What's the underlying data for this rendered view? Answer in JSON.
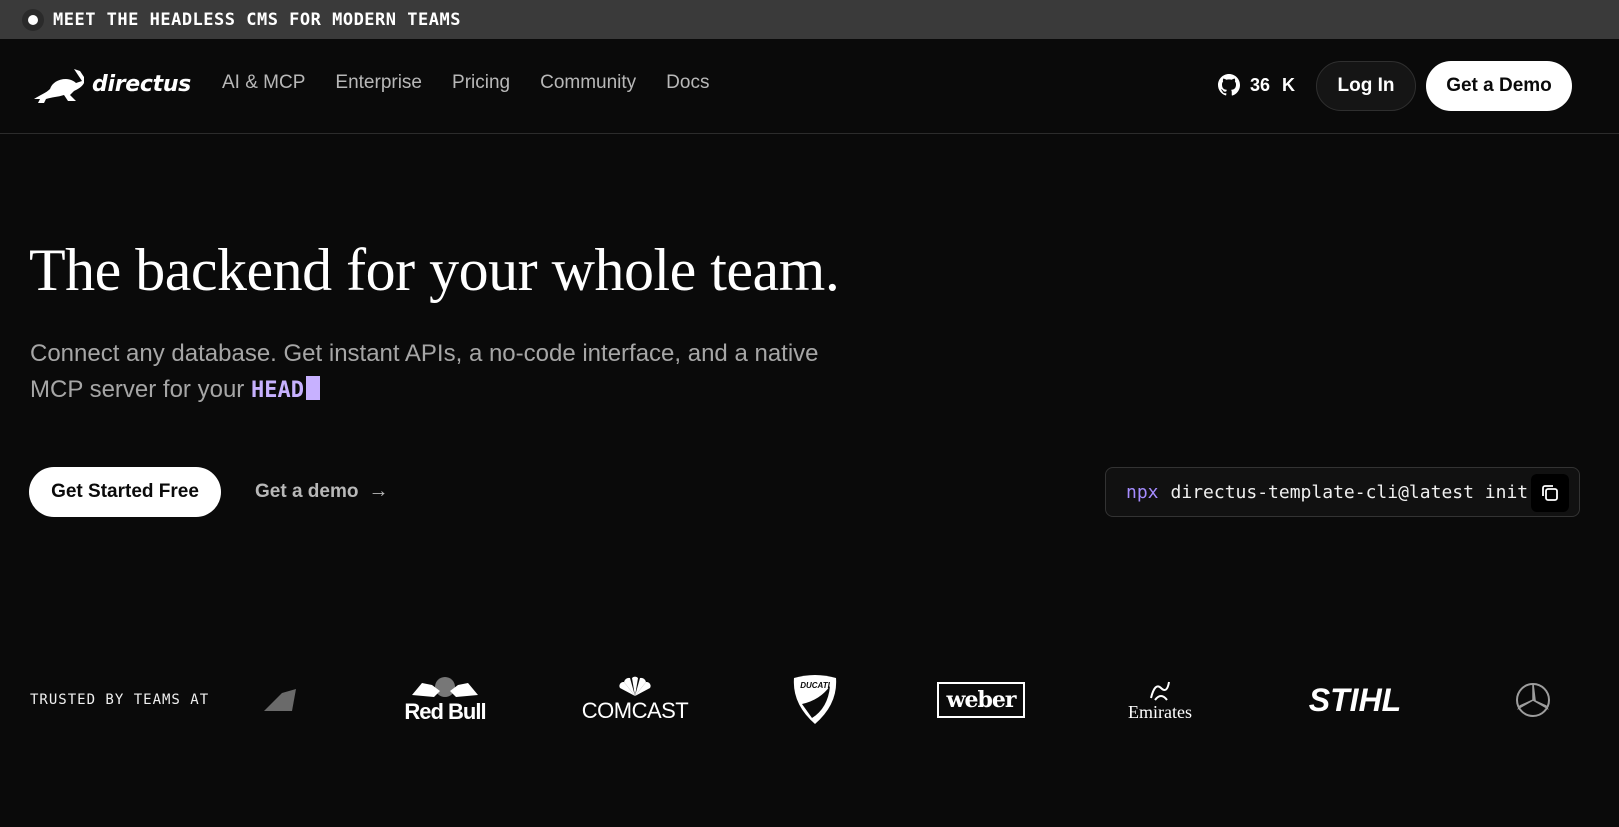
{
  "announcement": {
    "text": "MEET THE HEADLESS CMS FOR MODERN TEAMS"
  },
  "nav": {
    "brand": "directus",
    "links": [
      "AI & MCP",
      "Enterprise",
      "Pricing",
      "Community",
      "Docs"
    ],
    "github": {
      "stars": "36",
      "suffix": "K",
      "icon": "github-icon"
    },
    "login_label": "Log In",
    "demo_label": "Get a Demo"
  },
  "hero": {
    "title": "The backend for your whole team.",
    "subtitle": "Connect any database. Get instant APIs, a no-code interface, and a native MCP server for your",
    "typed_word": "HEAD",
    "primary_cta": "Get Started Free",
    "secondary_cta": "Get a demo",
    "command": {
      "prefix": "npx",
      "text": "directus-template-cli@latest init",
      "copy_icon": "copy-icon"
    }
  },
  "trusted": {
    "label": "TRUSTED BY TEAMS AT",
    "logos": [
      "Red Bull",
      "COMCAST",
      "DUCATI",
      "weber",
      "Emirates",
      "STIHL"
    ]
  },
  "colors": {
    "accent": "#c7b1ff",
    "npx": "#a58cff",
    "background": "#0a0a0a",
    "announce_bg": "#3a3a3a"
  }
}
